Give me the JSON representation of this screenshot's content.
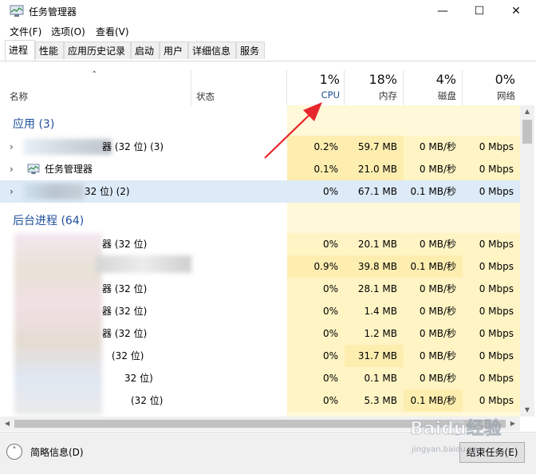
{
  "window": {
    "title": "任务管理器",
    "controls": {
      "minimize": "—",
      "maximize": "☐",
      "close": "✕"
    }
  },
  "menu": [
    "文件(F)",
    "选项(O)",
    "查看(V)"
  ],
  "tabs": [
    {
      "label": "进程",
      "active": true
    },
    {
      "label": "性能",
      "active": false
    },
    {
      "label": "应用历史记录",
      "active": false
    },
    {
      "label": "启动",
      "active": false
    },
    {
      "label": "用户",
      "active": false
    },
    {
      "label": "详细信息",
      "active": false
    },
    {
      "label": "服务",
      "active": false
    }
  ],
  "header": {
    "name": "名称",
    "status": "状态",
    "cpu": {
      "pct": "1%",
      "label": "CPU"
    },
    "memory": {
      "pct": "18%",
      "label": "内存"
    },
    "disk": {
      "pct": "4%",
      "label": "磁盘"
    },
    "network": {
      "pct": "0%",
      "label": "网络"
    }
  },
  "groups": {
    "apps": "应用 (3)",
    "background": "后台进程 (64)"
  },
  "apps": [
    {
      "name": "器 (32 位) (3)",
      "cpu": "0.2%",
      "mem": "59.7 MB",
      "disk": "0 MB/秒",
      "net": "0 Mbps"
    },
    {
      "name": "任务管理器",
      "cpu": "0.1%",
      "mem": "21.0 MB",
      "disk": "0 MB/秒",
      "net": "0 Mbps"
    },
    {
      "name": "32 位) (2)",
      "cpu": "0%",
      "mem": "67.1 MB",
      "disk": "0.1 MB/秒",
      "net": "0 Mbps"
    }
  ],
  "background": [
    {
      "name": "器 (32 位)",
      "cpu": "0%",
      "mem": "20.1 MB",
      "disk": "0 MB/秒",
      "net": "0 Mbps"
    },
    {
      "name": "",
      "cpu": "0.9%",
      "mem": "39.8 MB",
      "disk": "0.1 MB/秒",
      "net": "0 Mbps"
    },
    {
      "name": "器 (32 位)",
      "cpu": "0%",
      "mem": "28.1 MB",
      "disk": "0 MB/秒",
      "net": "0 Mbps"
    },
    {
      "name": "器 (32 位)",
      "cpu": "0%",
      "mem": "1.4 MB",
      "disk": "0 MB/秒",
      "net": "0 Mbps"
    },
    {
      "name": "器 (32 位)",
      "cpu": "0%",
      "mem": "1.2 MB",
      "disk": "0 MB/秒",
      "net": "0 Mbps"
    },
    {
      "name": "(32 位)",
      "cpu": "0%",
      "mem": "31.7 MB",
      "disk": "0 MB/秒",
      "net": "0 Mbps"
    },
    {
      "name": "32 位)",
      "cpu": "0%",
      "mem": "0.1 MB",
      "disk": "0 MB/秒",
      "net": "0 Mbps"
    },
    {
      "name": "(32 位)",
      "cpu": "0%",
      "mem": "5.3 MB",
      "disk": "0.1 MB/秒",
      "net": "0 Mbps"
    }
  ],
  "footer": {
    "less_details": "简略信息(D)",
    "end_task": "结束任务(E)"
  },
  "watermark": {
    "brand": "Baidu经验",
    "url": "jingyan.baidu.com"
  },
  "colors": {
    "group_title": "#1f4e9a",
    "cell_light": "#fff4c4",
    "cell_mid": "#fdeeb0",
    "selected_row": "#ddeaf7",
    "annotation_arrow": "#e8262d"
  }
}
